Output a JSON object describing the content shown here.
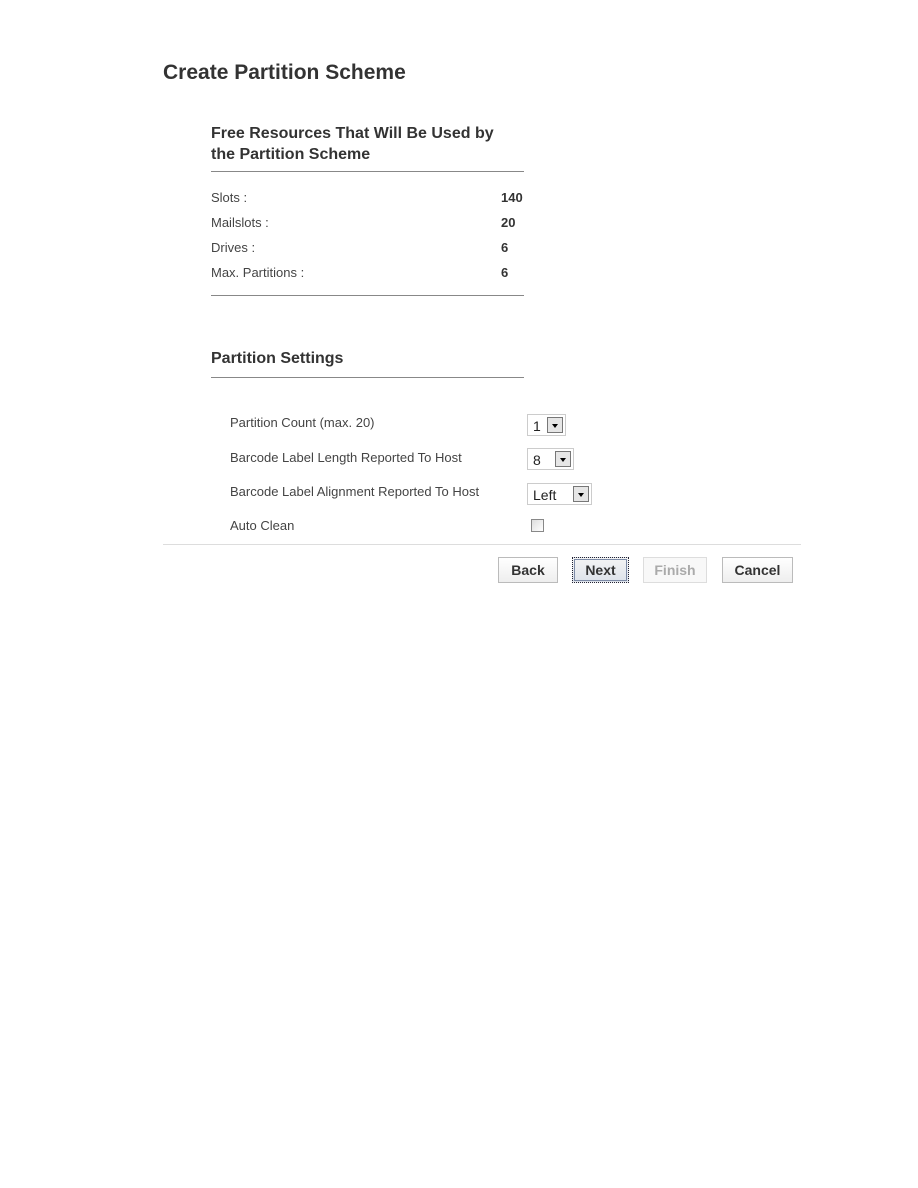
{
  "page": {
    "title": "Create Partition Scheme"
  },
  "resources": {
    "heading_line1": "Free Resources That Will Be Used by",
    "heading_line2": "the Partition Scheme",
    "rows": [
      {
        "label": "Slots :",
        "value": "140"
      },
      {
        "label": "Mailslots :",
        "value": "20"
      },
      {
        "label": "Drives :",
        "value": "6"
      },
      {
        "label": "Max. Partitions :",
        "value": "6"
      }
    ]
  },
  "settings": {
    "heading": "Partition Settings",
    "partition_count": {
      "label": "Partition Count (max. 20)",
      "value": "1"
    },
    "barcode_length": {
      "label": "Barcode Label Length Reported To Host",
      "value": "8"
    },
    "barcode_alignment": {
      "label": "Barcode Label Alignment Reported To Host",
      "value": "Left"
    },
    "auto_clean": {
      "label": "Auto Clean",
      "checked": false
    }
  },
  "buttons": {
    "back": "Back",
    "next": "Next",
    "finish": "Finish",
    "cancel": "Cancel"
  }
}
